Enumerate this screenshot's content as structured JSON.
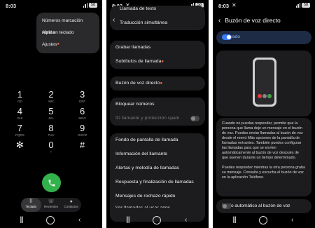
{
  "status": {
    "time": "8:03",
    "battery": "58"
  },
  "dialer": {
    "menu": [
      "Números marcación rápida",
      "Abrir en teclado",
      "Ajustes"
    ],
    "keys": [
      {
        "num": "1",
        "letters": "GD"
      },
      {
        "num": "2",
        "letters": "ABC"
      },
      {
        "num": "3",
        "letters": "DEF"
      },
      {
        "num": "4",
        "letters": "GHI"
      },
      {
        "num": "5",
        "letters": "JKL"
      },
      {
        "num": "6",
        "letters": "MNO"
      },
      {
        "num": "7",
        "letters": "PQRS"
      },
      {
        "num": "8",
        "letters": "TUV"
      },
      {
        "num": "9",
        "letters": "WXYZ"
      },
      {
        "num": "✻",
        "letters": ""
      },
      {
        "num": "0",
        "letters": "+"
      },
      {
        "num": "#",
        "letters": ""
      }
    ],
    "tabs": [
      "Teclado",
      "Recientes",
      "Contactos"
    ]
  },
  "settings": {
    "top_rows": [
      "Llamada de texto",
      "Traducción simultánea"
    ],
    "group1": [
      "Grabar llamadas",
      "Subtítulos de llamada"
    ],
    "voicemail": "Buzón de voz directo",
    "group2": [
      "Bloquear números",
      "ID llamante y protección spam"
    ],
    "group3": [
      "Fondo de pantalla de llamada",
      "Información del llamante",
      "Alertas y melodía de llamadas",
      "Respuesta y finalización de llamadas",
      "Mensajes de rechazo rápido",
      "Ver llamadas al usar apps"
    ]
  },
  "voicemail": {
    "title": "Buzón de voz directo",
    "activated_label": "Activado",
    "activated": true,
    "description_1": "Cuando no puedas responder, permite que la persona que llama deje un mensaje en el buzón de voz. Puedes enviar llamadas al buzón de voz desde el menú Más opciones de la pantalla de llamadas entrantes. También puedes configurar las llamadas para que se envíen automáticamente al buzón de voz después de que suenen durante un tiempo determinado.",
    "description_2": "Puedes responder mientras la otra persona graba su mensaje. Consulta y escucha el buzón de voz en la aplicación Teléfono.",
    "auto_label": "Envío automático al buzón de voz",
    "auto": false
  },
  "colors": {
    "call_green": "#33b14b",
    "accent_blue": "#3a7cff",
    "badge_orange": "#ff7043"
  },
  "icons": {
    "call": "phone-icon",
    "keypad": "keypad-icon",
    "recents": "recents-icon",
    "contacts": "contacts-icon"
  }
}
